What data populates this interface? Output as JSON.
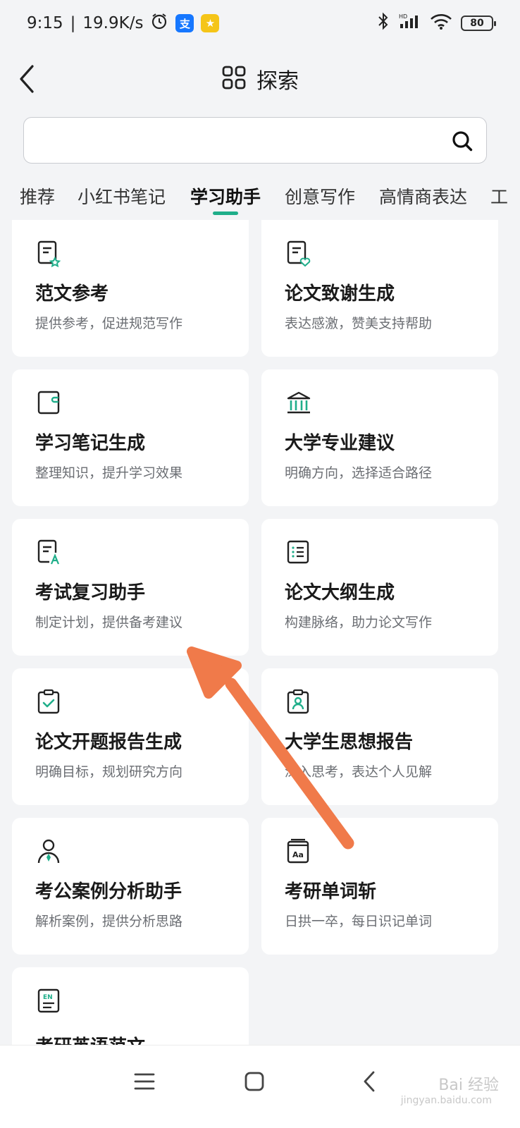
{
  "status_bar": {
    "time": "9:15",
    "speed": "19.9K/s",
    "battery": "80",
    "icons": [
      "alarm-icon",
      "alipay-icon",
      "app-icon",
      "bluetooth-icon",
      "signal-icon",
      "wifi-icon",
      "battery-icon"
    ],
    "hd": "HD"
  },
  "header": {
    "title": "探索"
  },
  "search": {
    "placeholder": ""
  },
  "tabs": [
    "推荐",
    "小红书笔记",
    "学习助手",
    "创意写作",
    "高情商表达",
    "工"
  ],
  "active_tab": "学习助手",
  "cards": [
    {
      "title": "范文参考",
      "desc": "提供参考，促进规范写作",
      "icon": "doc-star-icon"
    },
    {
      "title": "论文致谢生成",
      "desc": "表达感激，赞美支持帮助",
      "icon": "doc-heart-icon"
    },
    {
      "title": "学习笔记生成",
      "desc": "整理知识，提升学习效果",
      "icon": "notebook-icon"
    },
    {
      "title": "大学专业建议",
      "desc": "明确方向，选择适合路径",
      "icon": "university-icon"
    },
    {
      "title": "考试复习助手",
      "desc": "制定计划，提供备考建议",
      "icon": "doc-a-icon"
    },
    {
      "title": "论文大纲生成",
      "desc": "构建脉络，助力论文写作",
      "icon": "list-icon"
    },
    {
      "title": "论文开题报告生成",
      "desc": "明确目标，规划研究方向",
      "icon": "clipboard-check-icon"
    },
    {
      "title": "大学生思想报告",
      "desc": "深入思考，表达个人见解",
      "icon": "clipboard-person-icon"
    },
    {
      "title": "考公案例分析助手",
      "desc": "解析案例，提供分析思路",
      "icon": "person-tie-icon"
    },
    {
      "title": "考研单词斩",
      "desc": "日拱一卒，每日识记单词",
      "icon": "book-aa-icon"
    },
    {
      "title": "考研英语范文",
      "desc": "",
      "icon": "doc-en-icon"
    }
  ],
  "watermark": {
    "brand": "Bai 经验",
    "site": "jingyan.baidu.com"
  },
  "colors": {
    "accent": "#1fae8a",
    "annotation_arrow": "#f07a4a"
  }
}
